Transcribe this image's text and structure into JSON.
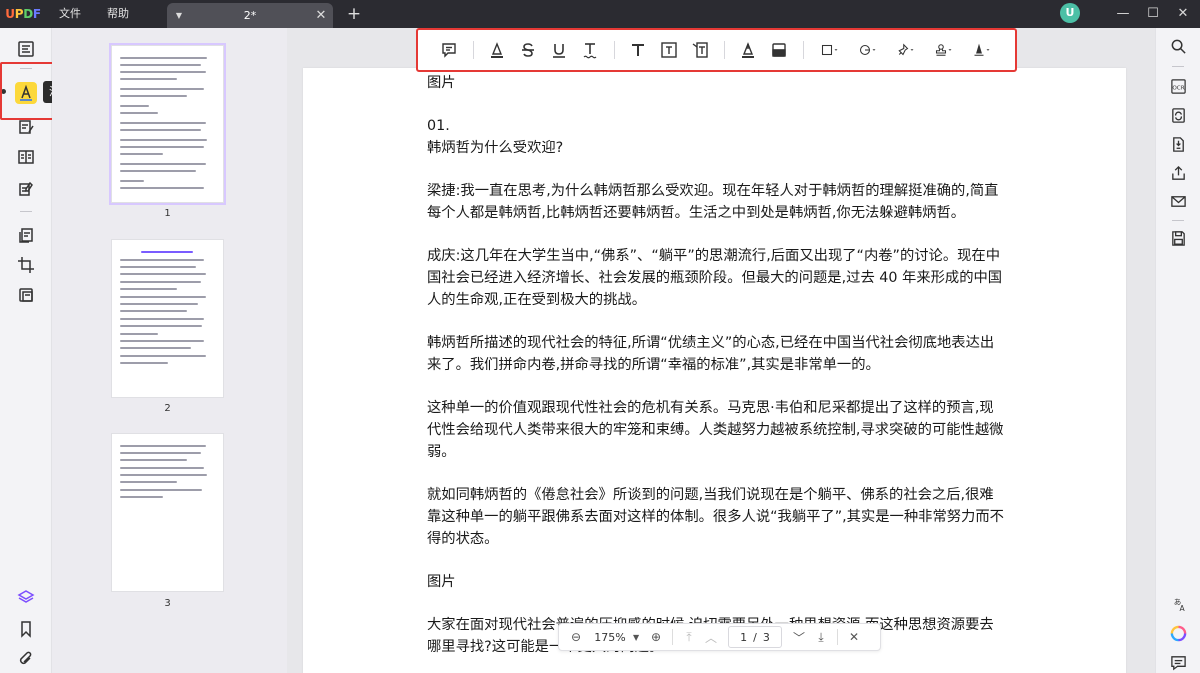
{
  "app": {
    "logo_text": "UPDF",
    "menu": [
      "文件",
      "帮助"
    ],
    "tab_title": "2*",
    "tab_add": "+",
    "user_initial": "U"
  },
  "colors": {
    "accent_yellow": "#fcd83a",
    "highlight_red": "#e53935",
    "titlebar_bg": "#2b2b31",
    "avatar_green": "#4cc0a6"
  },
  "left_rail": {
    "tooltip": "注释",
    "tools": [
      "reader-icon",
      "comment-highlighter-icon",
      "edit-text-icon",
      "page-layout-icon",
      "fill-sign-icon",
      "organize-pages-icon",
      "crop-icon",
      "protect-icon"
    ],
    "bottom": [
      "layers-icon",
      "bookmark-icon",
      "attachment-icon"
    ]
  },
  "thumbnails": {
    "pages": [
      {
        "label": "1",
        "selected": true
      },
      {
        "label": "2",
        "selected": false
      },
      {
        "label": "3",
        "selected": false
      }
    ]
  },
  "toolbar": {
    "tools": [
      "sticky-note-icon",
      "highlight-icon",
      "strikethrough-icon",
      "underline-icon",
      "squiggly-underline-icon",
      "text-icon",
      "text-box-icon",
      "text-callout-icon",
      "pencil-icon",
      "eraser-icon",
      "rectangle-shape-icon",
      "shape-circle-icon",
      "pin-icon",
      "stamp-icon",
      "signature-icon"
    ]
  },
  "document": {
    "paragraphs": [
      "图片",
      "01.\n韩炳哲为什么受欢迎?",
      "梁捷:我一直在思考,为什么韩炳哲那么受欢迎。现在年轻人对于韩炳哲的理解挺准确的,简直每个人都是韩炳哲,比韩炳哲还要韩炳哲。生活之中到处是韩炳哲,你无法躲避韩炳哲。",
      "成庆:这几年在大学生当中,“佛系”、“躺平”的思潮流行,后面又出现了“内卷”的讨论。现在中国社会已经进入经济增长、社会发展的瓶颈阶段。但最大的问题是,过去 40 年来形成的中国人的生命观,正在受到极大的挑战。",
      "韩炳哲所描述的现代社会的特征,所谓“优绩主义”的心态,已经在中国当代社会彻底地表达出来了。我们拼命内卷,拼命寻找的所谓“幸福的标准”,其实是非常单一的。",
      "这种单一的价值观跟现代性社会的危机有关系。马克思·韦伯和尼采都提出了这样的预言,现代性会给现代人类带来很大的牢笼和束缚。人类越努力越被系统控制,寻求突破的可能性越微弱。",
      "就如同韩炳哲的《倦怠社会》所谈到的问题,当我们说现在是个躺平、佛系的社会之后,很难靠这种单一的躺平跟佛系去面对这样的体制。很多人说“我躺平了”,其实是一种非常努力而不得的状态。",
      "图片",
      "大家在面对现代社会普遍的压抑感的时候,迫切需要另外一种思想资源,而这种思想资源要去哪里寻找?这可能是一个更大的问题。"
    ]
  },
  "zoom": {
    "level": "175%",
    "current_page": "1",
    "separator": "/",
    "total_pages": "3"
  },
  "right_rail": {
    "tools": [
      "search-icon",
      "ocr-icon",
      "convert-icon",
      "compress-icon",
      "share-icon",
      "email-icon",
      "save-icon",
      "translate-icon",
      "ai-assistant-icon",
      "comment-panel-icon"
    ]
  }
}
